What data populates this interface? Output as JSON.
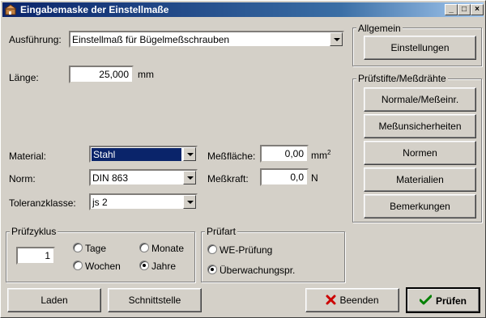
{
  "window": {
    "title": "Eingabemaske der Einstellmaße",
    "controls": {
      "minimize": "_",
      "maximize": "□",
      "close": "×"
    }
  },
  "fields": {
    "ausfuehrung_label": "Ausführung:",
    "ausfuehrung_value": "Einstellmaß für Bügelmeßschrauben",
    "laenge_label": "Länge:",
    "laenge_value": "25,000",
    "laenge_unit": "mm",
    "material_label": "Material:",
    "material_value": "Stahl",
    "norm_label": "Norm:",
    "norm_value": "DIN 863",
    "toleranz_label": "Toleranzklasse:",
    "toleranz_value": "js 2",
    "messflaeche_label": "Meßfläche:",
    "messflaeche_value": "0,00",
    "messflaeche_unit": "mm",
    "messflaeche_sup": "2",
    "messkraft_label": "Meßkraft:",
    "messkraft_value": "0,0",
    "messkraft_unit": "N"
  },
  "pruefzyklus": {
    "title": "Prüfzyklus",
    "value": "1",
    "options": [
      {
        "label": "Tage",
        "selected": false
      },
      {
        "label": "Monate",
        "selected": false
      },
      {
        "label": "Wochen",
        "selected": false
      },
      {
        "label": "Jahre",
        "selected": true
      }
    ]
  },
  "pruefart": {
    "title": "Prüfart",
    "options": [
      {
        "label": "WE-Prüfung",
        "selected": false
      },
      {
        "label": "Überwachungspr.",
        "selected": true
      }
    ]
  },
  "allgemein": {
    "title": "Allgemein",
    "button": "Einstellungen"
  },
  "pruefstifte": {
    "title": "Prüfstifte/Meßdrähte",
    "buttons": [
      "Normale/Meßeinr.",
      "Meßunsicherheiten",
      "Normen",
      "Materialien",
      "Bemerkungen"
    ]
  },
  "bottom": {
    "laden": "Laden",
    "schnittstelle": "Schnittstelle",
    "beenden": "Beenden",
    "pruefen": "Prüfen"
  },
  "colors": {
    "titlebar_start": "#0a246a",
    "face": "#d4d0c8",
    "selection": "#0a246a",
    "cancel_icon": "#cc0000",
    "ok_icon": "#008000"
  }
}
